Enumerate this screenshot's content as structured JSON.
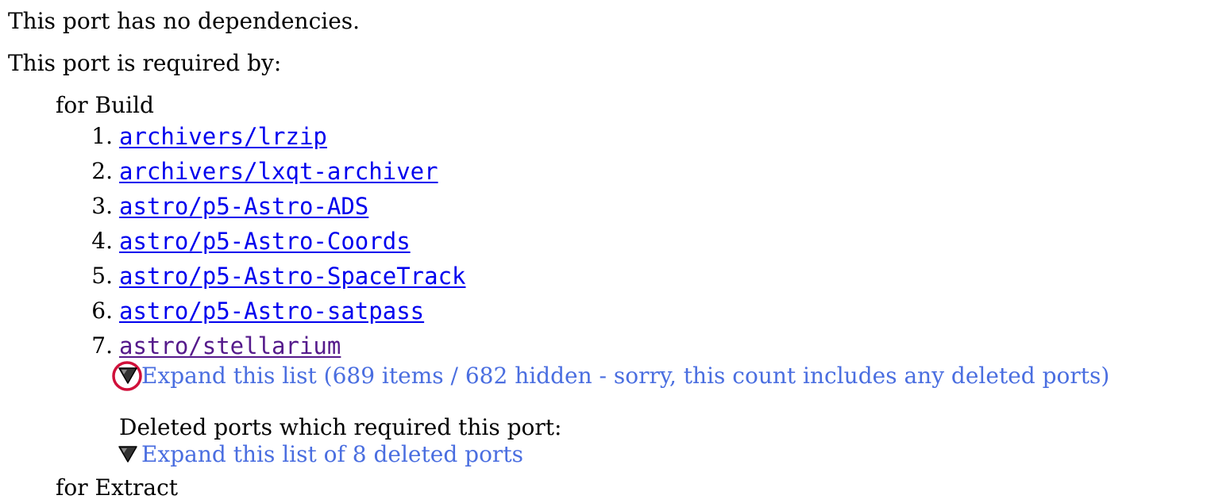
{
  "no_dependencies_text": "This port has no dependencies.",
  "required_by_heading": "This port is required by:",
  "build_section": {
    "label": "for Build",
    "ports": [
      {
        "number": "1.",
        "name": "archivers/lrzip"
      },
      {
        "number": "2.",
        "name": "archivers/lxqt-archiver"
      },
      {
        "number": "3.",
        "name": "astro/p5-Astro-ADS"
      },
      {
        "number": "4.",
        "name": "astro/p5-Astro-Coords"
      },
      {
        "number": "5.",
        "name": "astro/p5-Astro-SpaceTrack"
      },
      {
        "number": "6.",
        "name": "astro/p5-Astro-satpass"
      },
      {
        "number": "7.",
        "name": "astro/stellarium"
      }
    ],
    "expand_label": "Expand this list (689 items / 682 hidden - sorry, this count includes any deleted ports)"
  },
  "deleted_section": {
    "heading": "Deleted ports which required this port:",
    "expand_label": "Expand this list of 8 deleted ports"
  },
  "extract_section": {
    "label": "for Extract"
  },
  "colors": {
    "link": "#0000ee",
    "visited_link": "#551a8b",
    "expand_link": "#4a6ee0",
    "highlight_ring": "#d0103a"
  }
}
